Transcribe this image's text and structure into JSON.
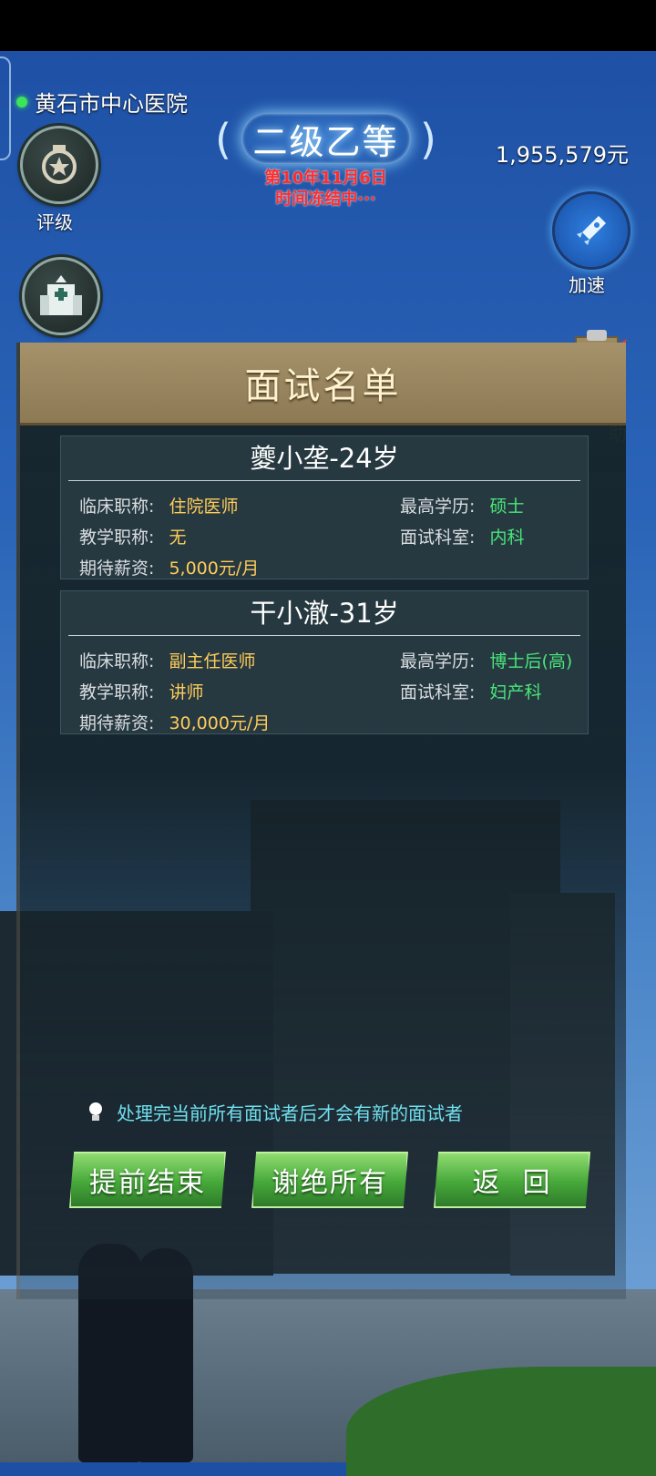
{
  "hospital_name": "黄石市中心医院",
  "rating_label": "评级",
  "rank": "二级乙等",
  "date_text": "第10年11月6日",
  "status_text": "时间冻结中···",
  "money": "1,955,579元",
  "speed_label": "加速",
  "help_label": "助",
  "panel_title": "面试名单",
  "candidates": [
    {
      "name": "夔小垄-24岁",
      "clinical_label": "临床职称:",
      "clinical": "住院医师",
      "edu_label": "最高学历:",
      "edu": "硕士",
      "teach_label": "教学职称:",
      "teach": "无",
      "dept_label": "面试科室:",
      "dept": "内科",
      "salary_label": "期待薪资:",
      "salary": "5,000元/月"
    },
    {
      "name": "干小澈-31岁",
      "clinical_label": "临床职称:",
      "clinical": "副主任医师",
      "edu_label": "最高学历:",
      "edu": "博士后(高)",
      "teach_label": "教学职称:",
      "teach": "讲师",
      "dept_label": "面试科室:",
      "dept": "妇产科",
      "salary_label": "期待薪资:",
      "salary": "30,000元/月"
    }
  ],
  "hint": "处理完当前所有面试者后才会有新的面试者",
  "buttons": {
    "end_early": "提前结束",
    "decline_all": "谢绝所有",
    "back": "返  回"
  },
  "colors": {
    "accent_green": "#49e67a",
    "gold": "#ffcc5a",
    "alert_red": "#ff2d2d",
    "header_tan": "#a5926a"
  }
}
